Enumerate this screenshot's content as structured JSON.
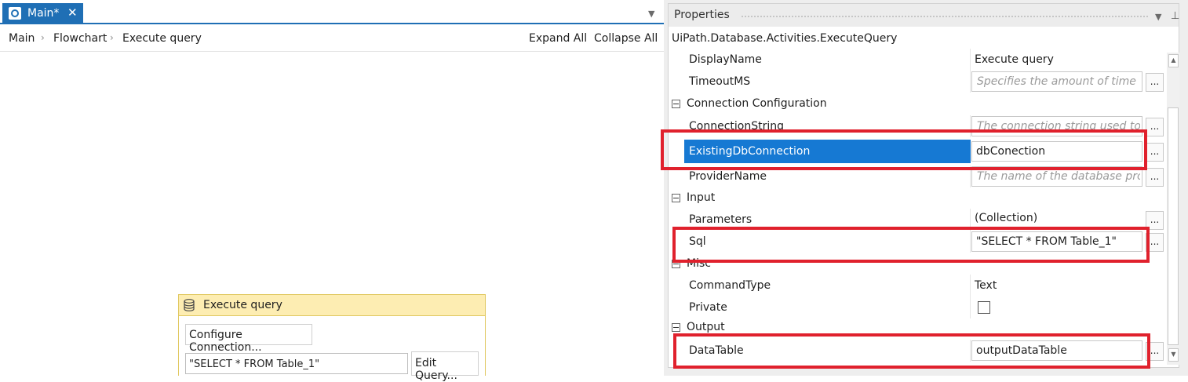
{
  "designer": {
    "tab": {
      "label": "Main*",
      "close": "✕"
    },
    "tab_dropdown": "▼",
    "breadcrumb": [
      "Main",
      "Flowchart",
      "Execute query"
    ],
    "breadcrumb_sep": "›",
    "expand_all": "Expand All",
    "collapse_all": "Collapse All",
    "activity": {
      "title": "Execute query",
      "configure_button": "Configure Connection...",
      "sql_value": "\"SELECT * FROM Table_1\"",
      "edit_query_button": "Edit Query..."
    }
  },
  "properties": {
    "title": "Properties",
    "dropdown": "▼",
    "pin": "⊥",
    "activity_type": "UiPath.Database.Activities.ExecuteQuery",
    "ellipsis": "...",
    "rows": {
      "display_name": {
        "name": "DisplayName",
        "value": "Execute query"
      },
      "timeout_ms": {
        "name": "TimeoutMS",
        "hint": "Specifies the amount of time (i"
      },
      "connection_string": {
        "name": "ConnectionString",
        "hint": "The connection string used to e"
      },
      "existing_db_connection": {
        "name": "ExistingDbConnection",
        "value": "dbConection"
      },
      "provider_name": {
        "name": "ProviderName",
        "hint": "The name of the database prov"
      },
      "parameters": {
        "name": "Parameters",
        "value": "(Collection)"
      },
      "sql": {
        "name": "Sql",
        "value": "\"SELECT * FROM Table_1\""
      },
      "command_type": {
        "name": "CommandType",
        "value": "Text"
      },
      "private": {
        "name": "Private",
        "checked": false
      },
      "data_table": {
        "name": "DataTable",
        "value": "outputDataTable"
      }
    },
    "categories": {
      "connection": "Connection Configuration",
      "input": "Input",
      "misc": "Misc",
      "output": "Output"
    }
  },
  "colors": {
    "accent": "#1f6fb5",
    "selection": "#1679d3",
    "highlight": "#e0212d",
    "activity_header": "#fdedb2"
  }
}
